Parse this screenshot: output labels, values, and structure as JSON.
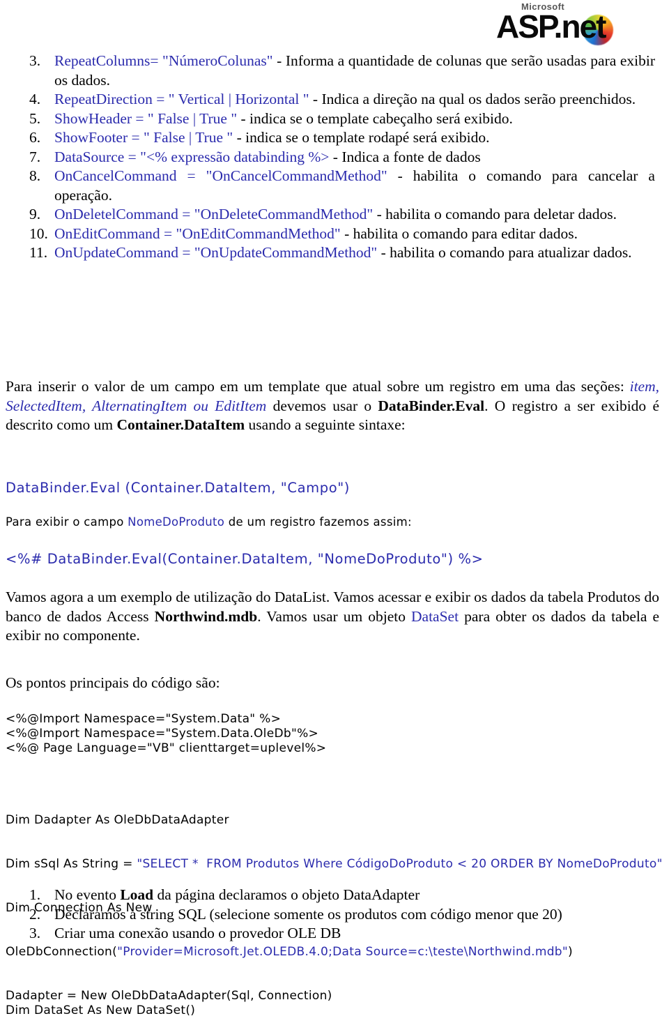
{
  "logo": {
    "microsoft": "Microsoft",
    "aspnet_asp": "ASP",
    "aspnet_dot": ".",
    "aspnet_net": "net"
  },
  "properties_list": {
    "items": [
      {
        "num": "3.",
        "code": "RepeatColumns= \"NúmeroColunas\"",
        "desc": " - Informa a quantidade de colunas que serão usadas para exibir os dados."
      },
      {
        "num": "4.",
        "code": "RepeatDirection = \" Vertical | Horizontal \"",
        "desc": " - Indica a direção na qual os dados serão preenchidos."
      },
      {
        "num": "5.",
        "code": "ShowHeader = \" False | True \"",
        "desc": " - indica se o template cabeçalho será exibido."
      },
      {
        "num": "6.",
        "code": "ShowFooter = \" False | True \"",
        "desc": " - indica se o template rodapé será exibido."
      },
      {
        "num": "7.",
        "code": "DataSource = \"<% expressão databinding %>",
        "desc": " - Indica a fonte de dados"
      },
      {
        "num": "8.",
        "code": "OnCancelCommand = \"OnCancelCommandMethod\"",
        "desc": " - habilita o comando para cancelar a operação."
      },
      {
        "num": "9.",
        "code": "OnDeletelCommand = \"OnDeleteCommandMethod\"",
        "desc": " - habilita o comando para deletar dados."
      },
      {
        "num": "10.",
        "code": "OnEditCommand = \"OnEditCommandMethod\"",
        "desc": " - habilita o comando para editar dados."
      },
      {
        "num": "11.",
        "code": "OnUpdateCommand = \"OnUpdateCommandMethod\"",
        "desc": " - habilita o comando para atualizar dados."
      }
    ]
  },
  "paragraph_1": {
    "part_1": "Para inserir o valor de um campo em um template que atual sobre um registro em uma das seções: ",
    "emphasis": "item, SelectedItem, AlternatingItem ou EditItem",
    "part_2": " devemos usar o ",
    "strong_1": "DataBinder.Eval",
    "part_3": ". O registro a ser exibido é descrito como um ",
    "strong_2": "Container.DataItem",
    "part_4": " usando a seguinte sintaxe:"
  },
  "code_eval": {
    "line": "DataBinder.Eval (Container.DataItem, \"Campo\")"
  },
  "note_1": {
    "part_1": "Para exibir o campo ",
    "field": "NomeDoProduto",
    "part_2": " de um registro fazemos assim:"
  },
  "code_bind": {
    "line": "<%# DataBinder.Eval(Container.DataItem, \"NomeDoProduto\") %>"
  },
  "paragraph_2": {
    "part_1": "Vamos agora a um exemplo de utilização do DataList. Vamos acessar e exibir os dados da tabela Produtos do banco de dados Access ",
    "strong_1": "Northwind.mdb",
    "part_2": ". Vamos usar um objeto ",
    "blue_1": "DataSet",
    "part_3": " para obter os dados da tabela e exibir no componente."
  },
  "paragraph_3": {
    "text": "Os pontos principais do código são:"
  },
  "code_header": {
    "line_1": "<%@Import Namespace=\"System.Data\" %>",
    "line_2": "<%@Import Namespace=\"System.Data.OleDb\"%>",
    "line_3": "<%@ Page Language=\"VB\" clienttarget=uplevel%>"
  },
  "code_vb": {
    "line_1": "Dim Dadapter As OleDbDataAdapter",
    "line_2_black": "Dim sSql As String = ",
    "line_2_blue": "\"SELECT *  FROM Produtos Where CódigoDoProduto < 20 ORDER BY NomeDoProduto\"",
    "line_3": "Dim Connection As New",
    "line_4_black_a": "OleDbConnection(",
    "line_4_blue": "\"Provider=Microsoft.Jet.OLEDB.4.0;Data Source=c:\\teste\\Northwind.mdb\"",
    "line_4_black_b": ")"
  },
  "steps_list": {
    "items": [
      {
        "num": "1.",
        "part_1": "No evento ",
        "strong": "Load",
        "part_2": " da página declaramos o objeto DataAdapter"
      },
      {
        "num": "2.",
        "part_1": "Declaramos a string SQL (selecione somente os produtos com código menor que 20)",
        "strong": "",
        "part_2": ""
      },
      {
        "num": "3.",
        "part_1": "Criar uma conexão usando o provedor OLE DB",
        "strong": "",
        "part_2": ""
      }
    ]
  },
  "code_tail": {
    "line_1": "Dadapter = New OleDbDataAdapter(Sql, Connection)",
    "line_2": "Dim DataSet As New DataSet()"
  },
  "colors": {
    "accent_blue": "#2b2bad",
    "text_black": "#000000",
    "background": "#ffffff"
  }
}
